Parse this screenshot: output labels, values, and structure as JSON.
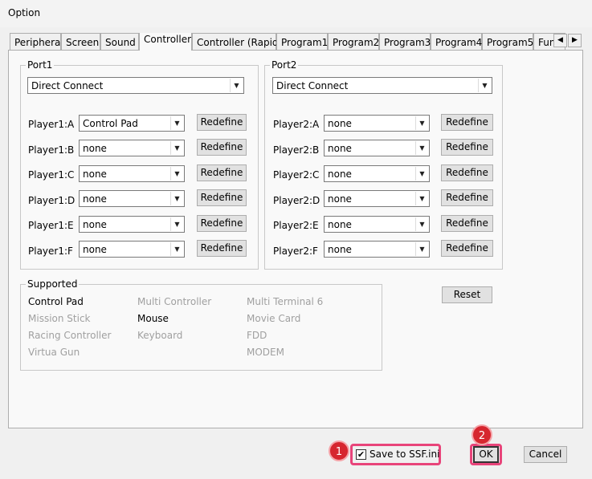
{
  "window": {
    "title": "Option"
  },
  "tabs": [
    {
      "label": "Peripheral"
    },
    {
      "label": "Screen"
    },
    {
      "label": "Sound"
    },
    {
      "label": "Controller"
    },
    {
      "label": "Controller (Rapid)"
    },
    {
      "label": "Program1"
    },
    {
      "label": "Program2"
    },
    {
      "label": "Program3"
    },
    {
      "label": "Program4"
    },
    {
      "label": "Program5"
    },
    {
      "label": "Fun"
    }
  ],
  "active_tab": "Controller",
  "port1": {
    "label": "Port1",
    "mode": "Direct Connect",
    "players": [
      {
        "label": "Player1:A",
        "value": "Control Pad",
        "redefine": "Redefine"
      },
      {
        "label": "Player1:B",
        "value": "none",
        "redefine": "Redefine"
      },
      {
        "label": "Player1:C",
        "value": "none",
        "redefine": "Redefine"
      },
      {
        "label": "Player1:D",
        "value": "none",
        "redefine": "Redefine"
      },
      {
        "label": "Player1:E",
        "value": "none",
        "redefine": "Redefine"
      },
      {
        "label": "Player1:F",
        "value": "none",
        "redefine": "Redefine"
      }
    ]
  },
  "port2": {
    "label": "Port2",
    "mode": "Direct Connect",
    "players": [
      {
        "label": "Player2:A",
        "value": "none",
        "redefine": "Redefine"
      },
      {
        "label": "Player2:B",
        "value": "none",
        "redefine": "Redefine"
      },
      {
        "label": "Player2:C",
        "value": "none",
        "redefine": "Redefine"
      },
      {
        "label": "Player2:D",
        "value": "none",
        "redefine": "Redefine"
      },
      {
        "label": "Player2:E",
        "value": "none",
        "redefine": "Redefine"
      },
      {
        "label": "Player2:F",
        "value": "none",
        "redefine": "Redefine"
      }
    ]
  },
  "supported": {
    "label": "Supported",
    "items": [
      {
        "label": "Control Pad",
        "enabled": true
      },
      {
        "label": "Multi Controller",
        "enabled": false
      },
      {
        "label": "Multi Terminal 6",
        "enabled": false
      },
      {
        "label": "Mission Stick",
        "enabled": false
      },
      {
        "label": "Mouse",
        "enabled": true
      },
      {
        "label": "Movie Card",
        "enabled": false
      },
      {
        "label": "Racing Controller",
        "enabled": false
      },
      {
        "label": "Keyboard",
        "enabled": false
      },
      {
        "label": "FDD",
        "enabled": false
      },
      {
        "label": "Virtua Gun",
        "enabled": false
      },
      {
        "label": "MODEM",
        "enabled": false
      }
    ]
  },
  "reset_label": "Reset",
  "footer": {
    "save_label": "Save to SSF.ini",
    "save_checked": true,
    "ok_label": "OK",
    "cancel_label": "Cancel"
  },
  "annotations": [
    {
      "number": "1"
    },
    {
      "number": "2"
    }
  ],
  "colors": {
    "highlight": "#e8447a",
    "badge": "#d6262f",
    "panel": "#f9f9f9",
    "dialog": "#f0f0f0"
  }
}
